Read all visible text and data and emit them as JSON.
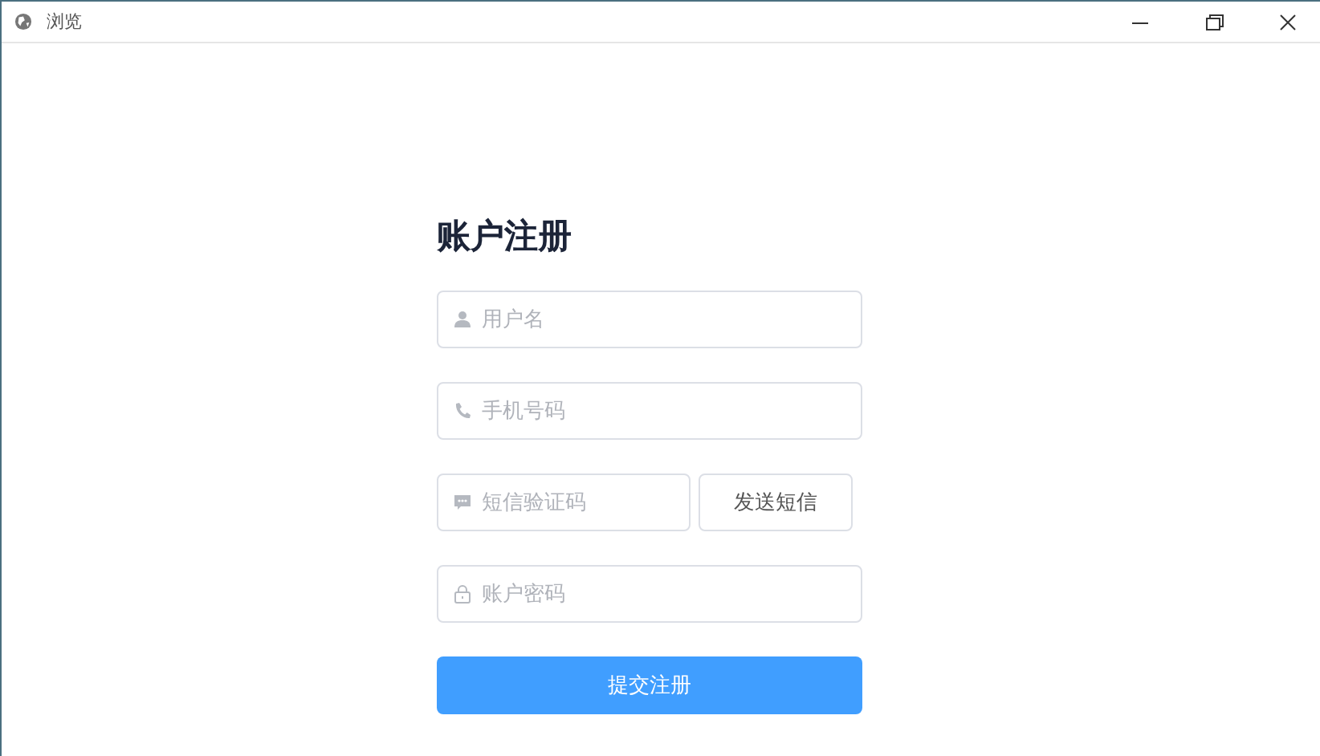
{
  "window": {
    "title": "浏览"
  },
  "form": {
    "title": "账户注册",
    "fields": [
      {
        "kind": "user",
        "placeholder": "用户名"
      },
      {
        "kind": "phone",
        "placeholder": "手机号码"
      },
      {
        "kind": "sms",
        "placeholder": "短信验证码",
        "button": "发送短信"
      },
      {
        "kind": "lock",
        "placeholder": "账户密码"
      }
    ],
    "submit": "提交注册"
  }
}
